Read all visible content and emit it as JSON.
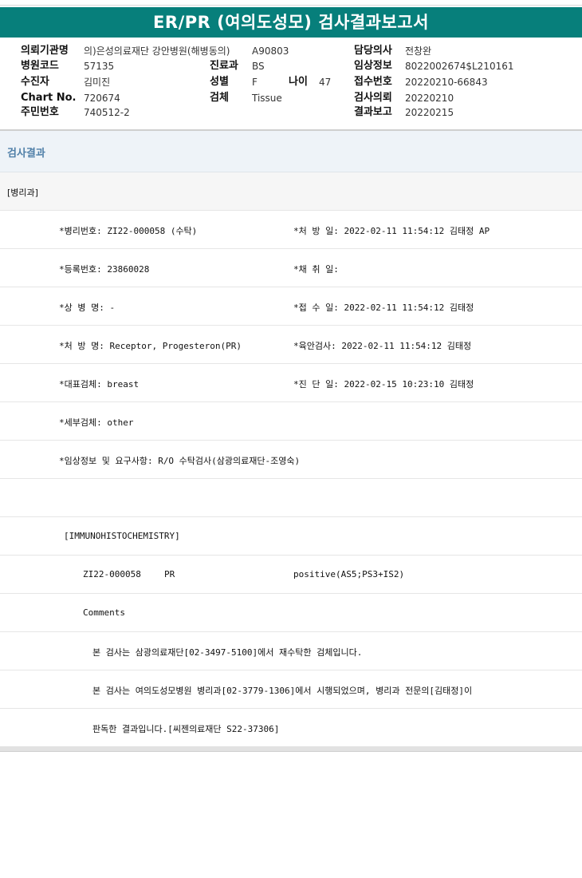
{
  "title": "ER/PR (여의도성모) 검사결과보고서",
  "header": {
    "hospital_label": "의뢰기관명",
    "hospital_value": "의)은성의료재단 강안병원(해병동의)",
    "hospital_code": "A90803",
    "doctor_label": "담당의사",
    "doctor_value": "전창완",
    "code_label": "병원코드",
    "code_value": "57135",
    "dept_label": "진료과",
    "dept_value": "BS",
    "clinical_label": "임상정보",
    "clinical_value": "8022002674$L210161",
    "patient_label": "수진자",
    "patient_value": "김미진",
    "sex_label": "성별",
    "sex_value": "F",
    "age_label": "나이",
    "age_value": "47",
    "receipt_label": "접수번호",
    "receipt_value": "20220210-66843",
    "chart_label": "Chart No.",
    "chart_value": "720674",
    "specimen_label": "검체",
    "specimen_value": "Tissue",
    "request_label": "검사의뢰",
    "request_value": "20220210",
    "id_label": "주민번호",
    "id_value": "740512-2",
    "report_label": "결과보고",
    "report_value": "20220215"
  },
  "section_title": "검사결과",
  "rows": {
    "r0": "[병리과]",
    "r1a": "*병리번호: ZI22-000058 (수탁)",
    "r1b": "*처 방 일: 2022-02-11 11:54:12  김태정 AP",
    "r2a": "*등록번호: 23860028",
    "r2b": "*채 취 일:",
    "r3a": "*상 병 명: -",
    "r3b": "*접 수 일: 2022-02-11 11:54:12  김태정",
    "r4a": "*처 방 명: Receptor, Progesteron(PR)",
    "r4b": "*육안검사: 2022-02-11 11:54:12  김태정",
    "r5a": "*대표검체: breast",
    "r5b": "*진 단 일: 2022-02-15 10:23:10  김태정",
    "r6a": "*세부검체: other",
    "r7a": "*임상정보 및 요구사항: R/O 수탁검사(삼광의료재단-조영숙)",
    "r8a": "",
    "r9a": "[IMMUNOHISTOCHEMISTRY]",
    "r10a": "ZI22-000058",
    "r10b": "PR",
    "r10c": "positive(AS5;PS3+IS2)",
    "r11a": "Comments",
    "r12a": "본 검사는 삼광의료재단[02-3497-5100]에서 재수탁한 검체입니다.",
    "r13a": "본 검사는 여의도성모병원 병리과[02-3779-1306]에서 시행되었으며, 병리과 전문의[김태정]이",
    "r14a": "판독한 결과입니다.[씨젠의료재단 S22-37306]"
  }
}
